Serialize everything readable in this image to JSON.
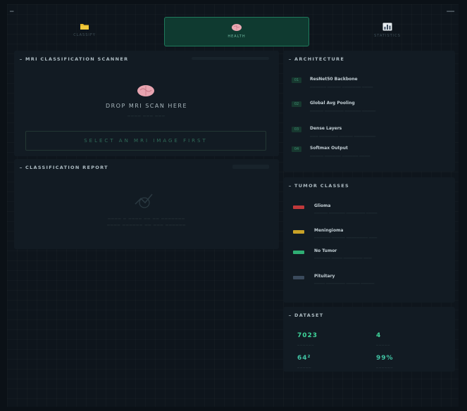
{
  "colors": {
    "accent": "#2ea57d",
    "stat_green": "#3fd49a",
    "stat_teal": "#41c4a4"
  },
  "tabs": [
    {
      "label": "CLASSIFY",
      "icon": "folder-icon"
    },
    {
      "label": "HEALTH",
      "icon": "brain-icon"
    },
    {
      "label": "STATISTICS",
      "icon": "bar-chart-icon"
    }
  ],
  "scanner": {
    "title": "MRI CLASSIFICATION SCANNER",
    "drop_text": "DROP MRI SCAN HERE",
    "select_label": "SELECT AN MRI IMAGE FIRST"
  },
  "report": {
    "title": "CLASSIFICATION REPORT"
  },
  "architecture": {
    "title": "ARCHITECTURE",
    "layers": [
      {
        "num": "01",
        "name": "ResNet50 Backbone"
      },
      {
        "num": "02",
        "name": "Global Avg Pooling"
      },
      {
        "num": "03",
        "name": "Dense Layers"
      },
      {
        "num": "04",
        "name": "Softmax Output"
      }
    ]
  },
  "classes": {
    "title": "TUMOR CLASSES",
    "items": [
      {
        "name": "Glioma",
        "color": "#c0393b"
      },
      {
        "name": "Meningioma",
        "color": "#c9a227"
      },
      {
        "name": "No Tumor",
        "color": "#2fae74"
      },
      {
        "name": "Pituitary",
        "color": "#3a4a5c"
      }
    ]
  },
  "dataset": {
    "title": "DATASET",
    "stats": [
      {
        "value": "7023"
      },
      {
        "value": "4"
      },
      {
        "value": "64²"
      },
      {
        "value": "99%"
      }
    ]
  }
}
